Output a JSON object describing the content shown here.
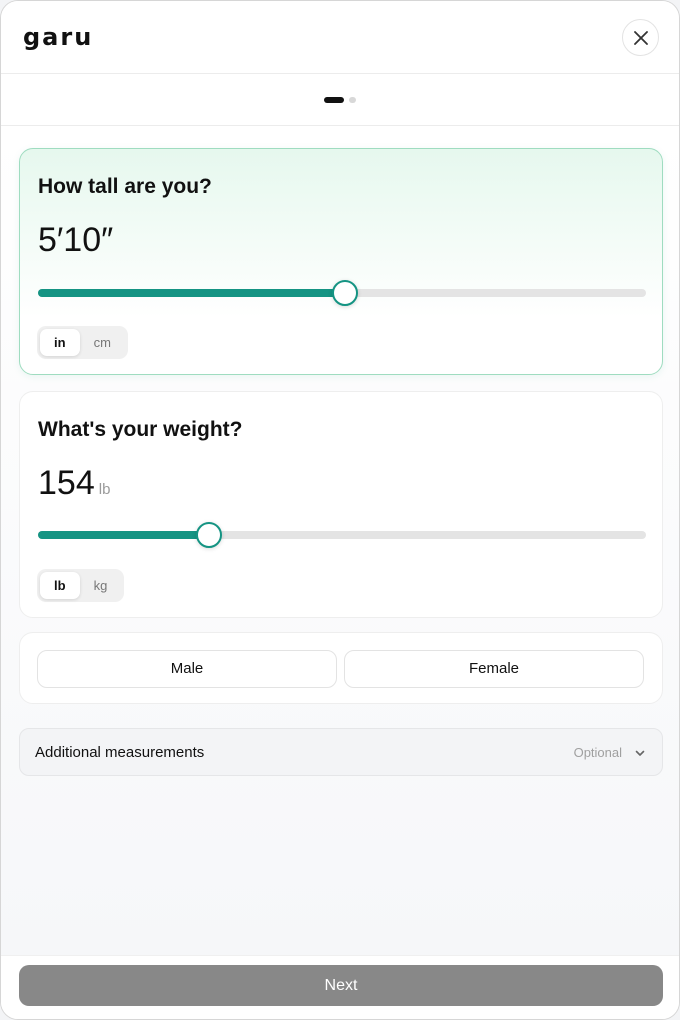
{
  "header": {
    "logo": "garu"
  },
  "steps": {
    "current": 1,
    "total": 2
  },
  "height": {
    "title": "How tall are you?",
    "value": "5′10″",
    "slider_fraction": 0.505,
    "units": [
      "in",
      "cm"
    ],
    "selected_unit": "in"
  },
  "weight": {
    "title": "What's your weight?",
    "value": "154",
    "unit_label": "lb",
    "slider_fraction": 0.282,
    "units": [
      "lb",
      "kg"
    ],
    "selected_unit": "lb"
  },
  "gender": {
    "options": [
      "Male",
      "Female"
    ]
  },
  "additional": {
    "label": "Additional measurements",
    "badge": "Optional"
  },
  "footer": {
    "next_label": "Next"
  },
  "colors": {
    "accent": "#159483",
    "button_disabled": "#888888"
  }
}
